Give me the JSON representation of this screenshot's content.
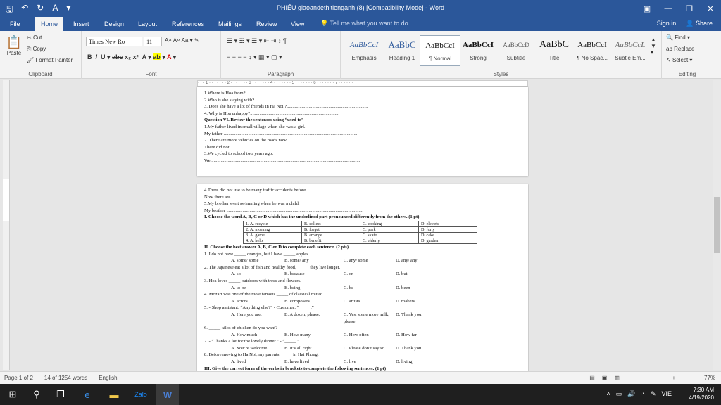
{
  "titlebar": {
    "title": "PHIẾU giaoandethitienganh (8) [Compatibility Mode] - Word",
    "save_icon": "save-icon",
    "undo": "↶",
    "redo": "↻"
  },
  "tabs": {
    "items": [
      "File",
      "Home",
      "Insert",
      "Design",
      "Layout",
      "References",
      "Mailings",
      "Review",
      "View"
    ],
    "tell_me": "Tell me what you want to do...",
    "sign_in": "Sign in",
    "share": "Share"
  },
  "ribbon": {
    "clipboard": {
      "paste": "Paste",
      "cut": "Cut",
      "copy": "Copy",
      "format_painter": "Format Painter",
      "label": "Clipboard"
    },
    "font": {
      "name": "Times New Ro",
      "size": "11",
      "label": "Font"
    },
    "paragraph": {
      "label": "Paragraph"
    },
    "styles": {
      "label": "Styles",
      "items": [
        {
          "sample": "AaBbCcI",
          "name": "Emphasis"
        },
        {
          "sample": "AaBbC",
          "name": "Heading 1"
        },
        {
          "sample": "AaBbCcI",
          "name": "¶ Normal"
        },
        {
          "sample": "AaBbCcI",
          "name": "Strong"
        },
        {
          "sample": "AaBbCcD",
          "name": "Subtitle"
        },
        {
          "sample": "AaBbC",
          "name": "Title"
        },
        {
          "sample": "AaBbCcI",
          "name": "¶ No Spac..."
        },
        {
          "sample": "AaBbCcL",
          "name": "Subtle Em..."
        }
      ]
    },
    "editing": {
      "find": "Find",
      "replace": "Replace",
      "select": "Select",
      "label": "Editing"
    }
  },
  "ruler": "· · · 1 · · · · · · · 2 · · · · · · · 3 · · · · · · · 4 · · · · · · · 5 · · · · · · · 6 · · · · · · · 7 · · · · · ·",
  "page1": {
    "lines": [
      "1.Where is Hoa from?.....................................................................",
      "2.Who is she staying with?.......................................................................",
      "3. Does she have a lot of friends in Ha Noi ?......................................................................",
      "4. Why is Hoa unhappy?.............................................................................",
      "Question VI.  Review the sentences using “used to”",
      "1.My father lived in small village when she was a girl.",
      "My father ...................................................................................................................",
      "2. There are more vehicles on the roads now.",
      "There did not ..................................................................................................................",
      "3.We cycled to school two years ago.",
      "We ................................................................................................................................"
    ]
  },
  "page2": {
    "intro": [
      "4.There did not use to be many traffic accidents before.",
      "Now there are .................................................................................................................",
      "5.My brother went swimming when he was a child.",
      "My brother ......................................................................................................................"
    ],
    "q1": "I. Choose the word A, B, C or D  which has the underlined part pronounced differently from the others. (1 pt)",
    "pron_table": [
      [
        "1. A. recycle",
        "B. collect",
        "C. cooking",
        "D. electric"
      ],
      [
        "2. A. morning",
        "B. forget",
        "C. pork",
        "D. forty"
      ],
      [
        "3. A. game",
        "B. arrange",
        "C. skate",
        "D. cake"
      ],
      [
        "4. A. help",
        "B. benefit",
        "C. elderly",
        "D. garden"
      ]
    ],
    "q2": "II. Choose the best answer A, B, C or D to complete each sentence. (2 pts)",
    "questions": [
      {
        "stem": "1. I do not have _____ oranges, but I have _____ apples.",
        "opts": [
          "A. some/ some",
          "B. some/ any",
          "C. any/ some",
          "D. any/ any"
        ]
      },
      {
        "stem": "2. The Japanese eat a lot of fish and healthy food, _____ they live longer.",
        "opts": [
          "A. so",
          "B. because",
          "C. or",
          "D. but"
        ]
      },
      {
        "stem": "3. Hoa loves _____ outdoors with trees and flowers.",
        "opts": [
          "A. to be",
          "B. being",
          "C. be",
          "D. been"
        ]
      },
      {
        "stem": "4. Mozart was one of the most famous _____ of classical music.",
        "opts": [
          "A. actors",
          "B. composers",
          "C. artists",
          "D. makers"
        ]
      },
      {
        "stem": "5. - Shop assistant: “Anything else?” - Customer: “_____.”",
        "opts": [
          "A. Here you are.",
          "B. A dozen, please.",
          "C. Yes, some more milk, please.",
          "D. Thank you."
        ]
      },
      {
        "stem": "6. _____ kilos of chicken do you want?",
        "opts": [
          "A. How much",
          "B. How many",
          "C. How often",
          "D. How far"
        ]
      },
      {
        "stem": "7. - “Thanks a lot for the lovely dinner.” - “_____.”",
        "opts": [
          "A. You’re welcome.",
          "B. It’s all right.",
          "C. Please don’t say so.",
          "D. Thank you."
        ]
      },
      {
        "stem": "8. Before moving to Ha Noi, my parents _____ in Hai Phong.",
        "opts": [
          "A. lived",
          "B. have lived",
          "C. live",
          "D. living"
        ]
      }
    ],
    "q3": "III. Give the correct form of the verbs in brackets to complete the following sentences. (1 pt)"
  },
  "status": {
    "page": "Page 1 of 2",
    "words": "14 of 1254 words",
    "language": "English",
    "zoom": "77%"
  },
  "taskbar": {
    "time": "7:30 AM",
    "date": "4/19/2020",
    "lang": "VIE"
  }
}
